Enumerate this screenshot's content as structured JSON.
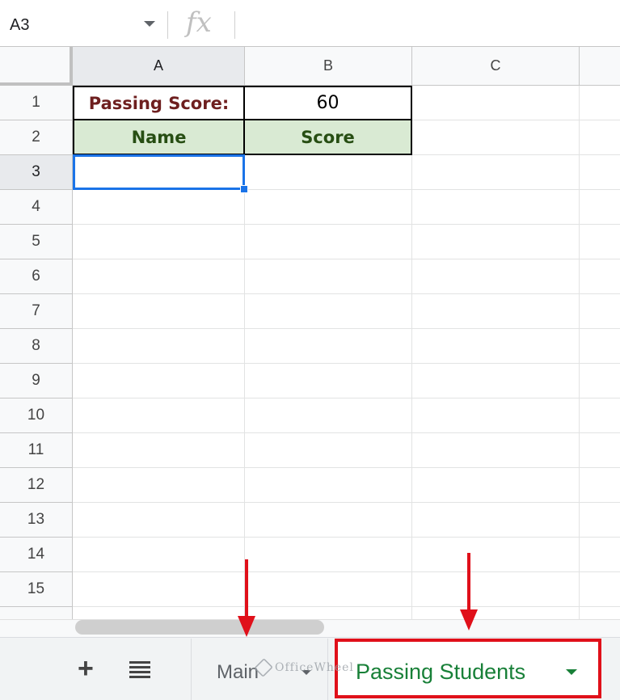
{
  "formula_bar": {
    "name_box_value": "A3",
    "fx_icon": "fx",
    "formula_value": ""
  },
  "columns": [
    {
      "label": "A",
      "selected": true
    },
    {
      "label": "B",
      "selected": false
    },
    {
      "label": "C",
      "selected": false
    }
  ],
  "rows": [
    "1",
    "2",
    "3",
    "4",
    "5",
    "6",
    "7",
    "8",
    "9",
    "10",
    "11",
    "12",
    "13",
    "14",
    "15"
  ],
  "selected_row": "3",
  "cells": {
    "A1": "Passing Score:",
    "B1": "60",
    "A2": "Name",
    "B2": "Score"
  },
  "sheet_tabs": {
    "add_icon": "+",
    "all_sheets_icon": "menu-lines-icon",
    "tabs": [
      {
        "label": "Main",
        "active": false
      },
      {
        "label": "Passing Students",
        "active": true
      }
    ]
  },
  "watermark": "OfficeWheel",
  "colors": {
    "header_fill": "#d9ead3",
    "header_text": "#274e13",
    "label_text": "#6e1f1f",
    "selection_blue": "#1a73e8",
    "annotation_red": "#e0101a",
    "active_tab_text": "#188038"
  }
}
